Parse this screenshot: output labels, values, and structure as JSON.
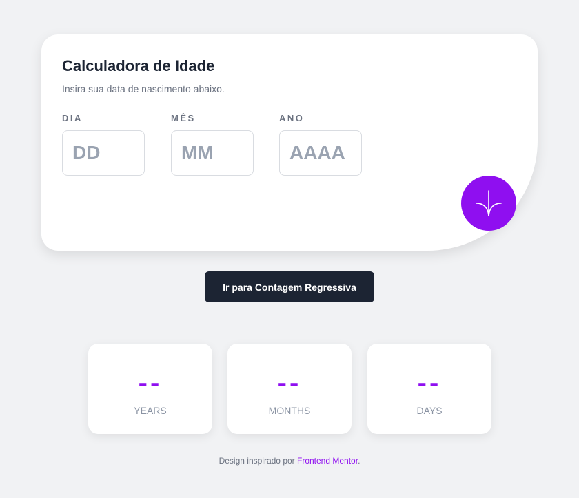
{
  "card": {
    "title": "Calculadora de Idade",
    "subtitle": "Insira sua data de nascimento abaixo."
  },
  "fields": {
    "day": {
      "label": "DIA",
      "placeholder": "DD",
      "value": ""
    },
    "month": {
      "label": "MÊS",
      "placeholder": "MM",
      "value": ""
    },
    "year": {
      "label": "ANO",
      "placeholder": "AAAA",
      "value": ""
    }
  },
  "submit": {
    "icon": "arrow-down-icon"
  },
  "countdown_button": {
    "label": "Ir para Contagem Regressiva"
  },
  "results": {
    "years": {
      "value": "--",
      "label": "YEARS"
    },
    "months": {
      "value": "--",
      "label": "MONTHS"
    },
    "days": {
      "value": "--",
      "label": "DAYS"
    }
  },
  "footer": {
    "prefix": "Design inspirado por ",
    "link_text": "Frontend Mentor",
    "suffix": "."
  },
  "colors": {
    "accent": "#8f0ff0",
    "dark": "#1c2433",
    "background": "#f1f2f4"
  }
}
